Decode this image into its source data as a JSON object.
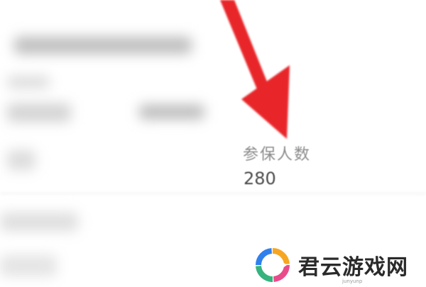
{
  "field": {
    "label": "参保人数",
    "value": "280"
  },
  "watermark": {
    "name": "君云游戏网",
    "domain": "junyunp"
  },
  "colors": {
    "arrow": "#e8282b",
    "label": "#8c8c8c",
    "value": "#4a4a4a"
  }
}
